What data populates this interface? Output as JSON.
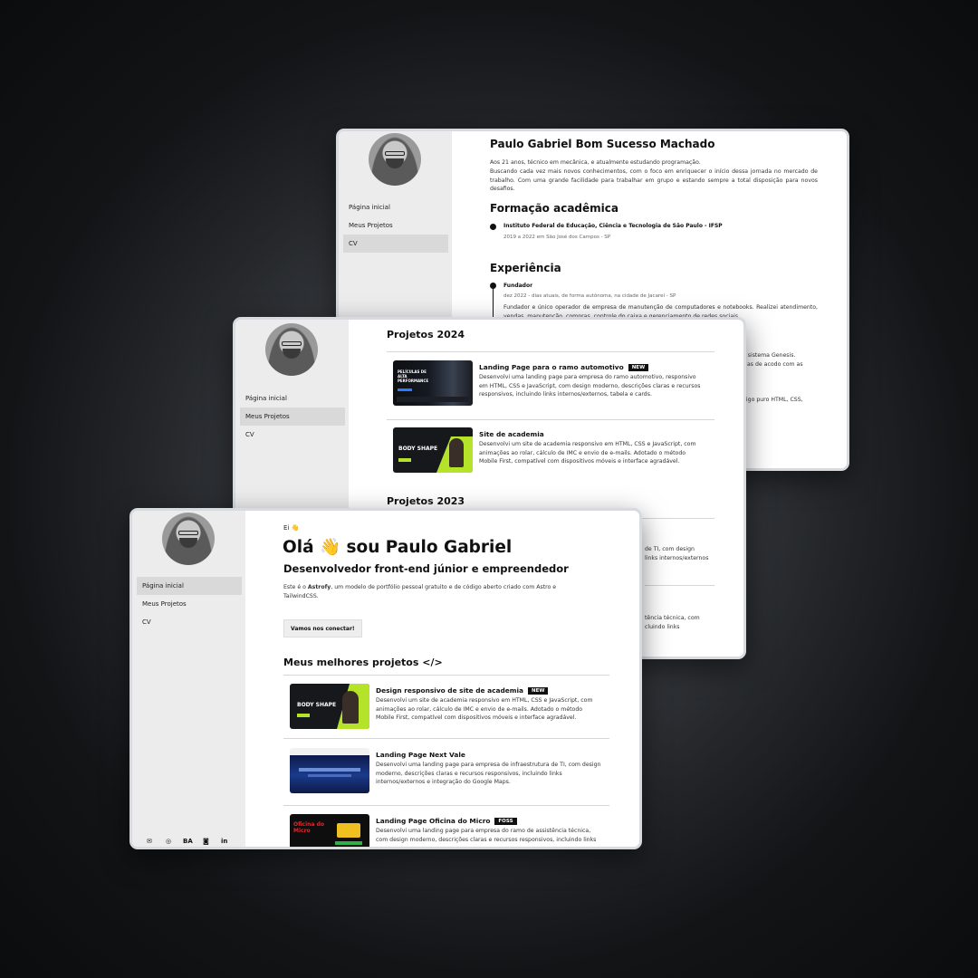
{
  "cv": {
    "nav": [
      "Página inicial",
      "Meus Projetos",
      "CV"
    ],
    "name": "Paulo Gabriel Bom Sucesso Machado",
    "bio1": "Aos 21 anos, técnico em mecânica, e atualmente estudando programação.",
    "bio2": "Buscando cada vez mais novos conhecimentos, com o foco em enriquecer o início dessa jornada no mercado de trabalho. Com uma grande facilidade para trabalhar em grupo e estando sempre a total disposição para novos desafios.",
    "education_title": "Formação acadêmica",
    "edu_school": "Instituto Federal de Educação, Ciência e Tecnologia de São Paulo - IFSP",
    "edu_date": "2019 a 2022 em São José dos Campos - SP",
    "experience_title": "Experiência",
    "exp_role": "Fundador",
    "exp_date": "dez 2022 - dias atuais, de forma autônoma, na cidade de Jacareí - SP",
    "exp_desc": "Fundador e único operador de empresa de manutenção de computadores e notebooks. Realizei atendimento, vendas, manutenção, compras, controle do caixa e gerenciamento de redes sociais.",
    "right_frag1": "o sistema Genesis.",
    "right_frag2": "as de acodo com as",
    "right_frag3": "digo puro HTML, CSS,"
  },
  "projects": {
    "nav": [
      "Página inicial",
      "Meus Projetos",
      "CV"
    ],
    "title_2024": "Projetos 2024",
    "p1_title": "Landing Page para o ramo automotivo",
    "p1_badge": "NEW",
    "p1_desc": "Desenvolvi uma landing page para empresa do ramo automotivo, responsivo em HTML, CSS e JavaScript, com design moderno, descrições claras e recursos responsivos, incluindo links internos/externos, tabela e cards.",
    "p2_title": "Site de academia",
    "p2_desc": "Desenvolvi um site de academia responsivo em HTML, CSS e JavaScript, com animações ao rolar, cálculo de IMC e envio de e-mails. Adotado o método Mobile First, compatível com dispositivos móveis e interface agradável.",
    "title_2023": "Projetos 2023",
    "frag1": "de TI, com design",
    "frag2": "links internos/externos",
    "frag3": "tência técnica, com",
    "frag4": "cluindo links",
    "thumb1_text": "PELÍCULAS DE ALTA PERFORMANCE",
    "thumb2_text": "BODY SHAPE"
  },
  "home": {
    "nav": [
      "Página inicial",
      "Meus Projetos",
      "CV"
    ],
    "greeting": "Ei 👋",
    "headline": "Olá 👋 sou Paulo Gabriel",
    "subtitle": "Desenvolvedor front-end júnior e empreendedor",
    "intro_pre": "Este é o ",
    "intro_bold": "Astrofy",
    "intro_post": ", um modelo de portfólio pessoal gratuito e de código aberto criado com Astro e TailwindCSS.",
    "cta": "Vamos nos conectar!",
    "best_title": "Meus melhores projetos </>",
    "b1_title": "Design responsivo de site de academia",
    "b1_badge": "NEW",
    "b1_desc": "Desenvolvi um site de academia responsivo em HTML, CSS e JavaScript, com animações ao rolar, cálculo de IMC e envio de e-mails. Adotado o método Mobile First, compatível com dispositivos móveis e interface agradável.",
    "b2_title": "Landing Page Next Vale",
    "b2_desc": "Desenvolvi uma landing page para empresa de infraestrutura de TI, com design moderno, descrições claras e recursos responsivos, incluindo links internos/externos e integração do Google Maps.",
    "b3_title": "Landing Page Oficina do Micro",
    "b3_badge": "FOSS",
    "b3_desc": "Desenvolvi uma landing page para empresa do ramo de assistência técnica, com design moderno, descrições claras e recursos responsivos, incluindo links",
    "thumb_body": "BODY SHAPE",
    "thumb_oficina": "Oficina do Micro",
    "social": [
      "✉",
      "◎",
      "BA",
      "◙",
      "in"
    ]
  }
}
